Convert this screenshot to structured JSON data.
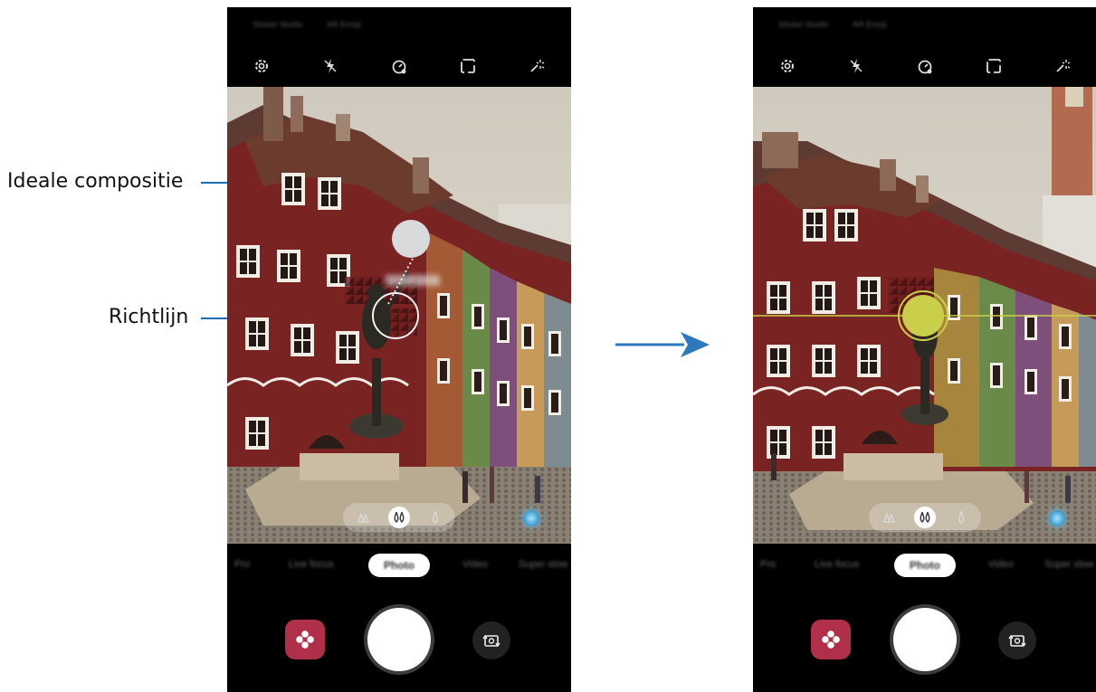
{
  "callouts": {
    "ideal_composition": "Ideale compositie",
    "guide_line": "Richtlijn"
  },
  "camera_before": {
    "status_left": "Sticker Studio",
    "status_right": "AR Emoji",
    "toolbar": [
      "settings-icon",
      "flash-off-icon",
      "timer-icon",
      "aspect-ratio-icon",
      "effects-icon"
    ],
    "filters": [
      "landscape-filter",
      "focus-filter",
      "single-drop-filter"
    ],
    "active_filter_index": 1,
    "modes": [
      "Pro",
      "Live focus",
      "Photo",
      "Video",
      "Super slow"
    ],
    "active_mode": "Photo"
  },
  "camera_after": {
    "status_left": "Sticker Studio",
    "status_right": "AR Emoji",
    "toolbar": [
      "settings-icon",
      "flash-off-icon",
      "timer-icon",
      "aspect-ratio-icon",
      "effects-icon"
    ],
    "filters": [
      "landscape-filter",
      "focus-filter",
      "single-drop-filter"
    ],
    "active_filter_index": 1,
    "modes": [
      "Pro",
      "Live focus",
      "Photo",
      "Video",
      "Super slow"
    ],
    "active_mode": "Photo"
  },
  "colors": {
    "callout_line": "#1d6fb3",
    "arrow": "#2c79bd",
    "guide_aligned": "#c9cf4b",
    "gallery_button": "#b0304a"
  }
}
